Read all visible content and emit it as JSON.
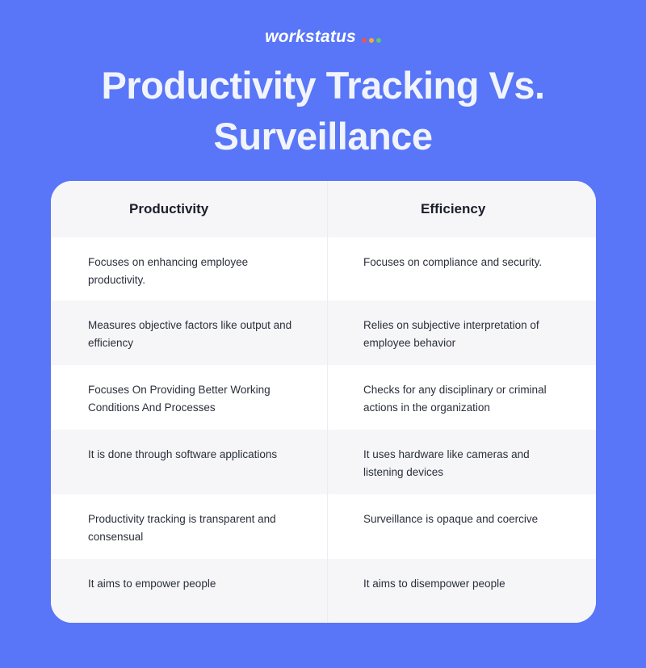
{
  "brand": {
    "name": "workstatus",
    "dot_colors": [
      "#e8545a",
      "#f0a93b",
      "#5cc96b"
    ]
  },
  "title": {
    "line1": "Productivity Tracking Vs.",
    "line2": "Surveillance"
  },
  "table": {
    "headers": [
      "Productivity",
      "Efficiency"
    ],
    "rows": [
      [
        "Focuses on enhancing employee productivity.",
        "Focuses on compliance and security."
      ],
      [
        "Measures objective factors like output and efficiency",
        "Relies on subjective interpretation of employee behavior"
      ],
      [
        "Focuses On Providing Better Working Conditions And Processes",
        "Checks for any disciplinary or criminal actions in the organization"
      ],
      [
        "It is done through software applications",
        "It uses hardware like cameras and listening devices"
      ],
      [
        "Productivity tracking is transparent and consensual",
        "Surveillance is opaque and coercive"
      ],
      [
        "It aims to empower people",
        "It aims to disempower people"
      ]
    ]
  },
  "colors": {
    "background": "#5876f7",
    "card": "#ffffff",
    "stripe": "#f6f6f9"
  }
}
